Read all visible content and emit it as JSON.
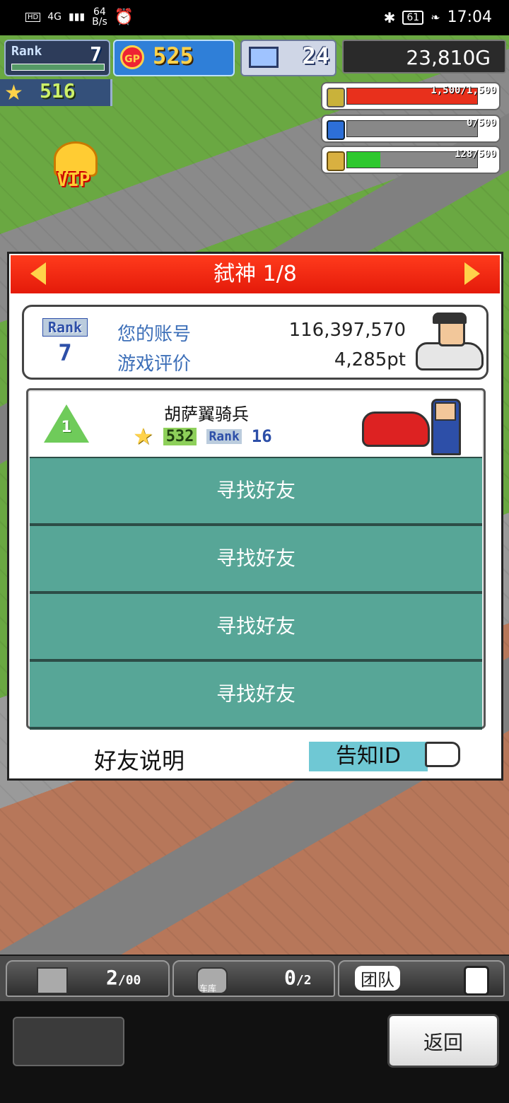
{
  "status_bar": {
    "network": "4G",
    "speed_value": "64",
    "speed_unit": "B/s",
    "battery": "61",
    "time": "17:04"
  },
  "hud": {
    "rank_label": "Rank",
    "rank_value": "7",
    "gp_label": "GP",
    "gp_value": "525",
    "pc_value": "24",
    "money": "23,810G",
    "stars": "516",
    "res_fuel": "1,500/1,500",
    "res_fuel_fill": 1.0,
    "res_water": "0/500",
    "res_water_fill": 0.0,
    "res_wheat": "128/500",
    "res_wheat_fill": 0.256,
    "vip": "VIP"
  },
  "panel": {
    "title": "弑神 1/8",
    "rank_label": "Rank",
    "rank_value": "7",
    "account_label": "您的账号",
    "account_value": "116,397,570",
    "rating_label": "游戏评价",
    "rating_value": "4,285pt",
    "friend": {
      "position": "1",
      "name": "胡萨翼骑兵",
      "stars": "532",
      "rank_label": "Rank",
      "rank_value": "16"
    },
    "slots": [
      "寻找好友",
      "寻找好友",
      "寻找好友",
      "寻找好友"
    ],
    "help_label": "好友说明",
    "tell_id_label": "告知ID"
  },
  "bottom": {
    "item_count": "2",
    "item_max": "00",
    "garage_label": "车库",
    "garage_count": "0",
    "garage_max": "2",
    "team_label": "团队",
    "back_label": "返回"
  }
}
